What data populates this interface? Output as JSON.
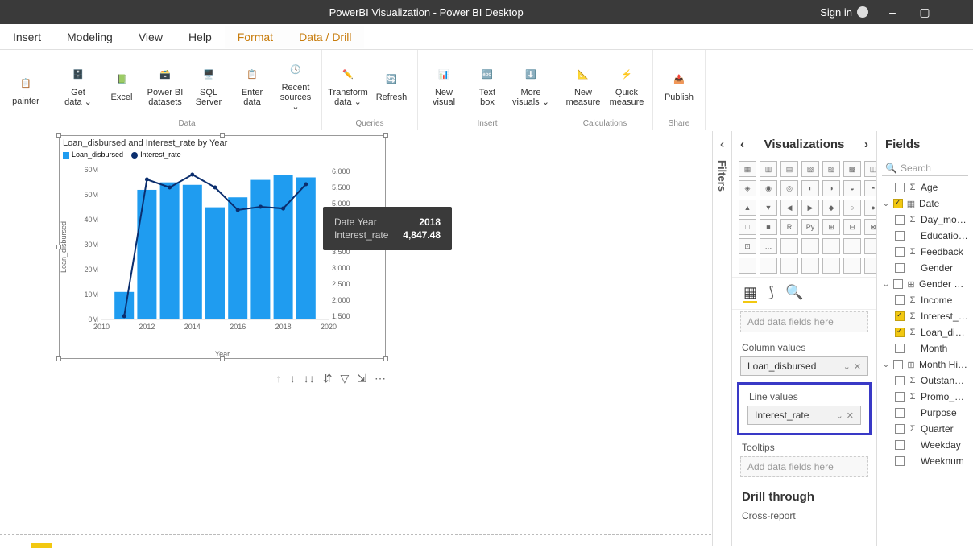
{
  "titlebar": {
    "title": "PowerBI Visualization - Power BI Desktop",
    "signin": "Sign in",
    "minimize": "–",
    "maximize": "▢",
    "close": ""
  },
  "menubar": {
    "items": [
      "Insert",
      "Modeling",
      "View",
      "Help",
      "Format",
      "Data / Drill"
    ],
    "active_from": 4
  },
  "ribbon": {
    "groups": [
      {
        "label": "",
        "items": [
          {
            "label": "painter"
          }
        ]
      },
      {
        "label": "Data",
        "items": [
          {
            "label": "Get\ndata ⌄"
          },
          {
            "label": "Excel"
          },
          {
            "label": "Power BI\ndatasets"
          },
          {
            "label": "SQL\nServer"
          },
          {
            "label": "Enter\ndata"
          },
          {
            "label": "Recent\nsources ⌄"
          }
        ]
      },
      {
        "label": "Queries",
        "items": [
          {
            "label": "Transform\ndata ⌄"
          },
          {
            "label": "Refresh"
          }
        ]
      },
      {
        "label": "Insert",
        "items": [
          {
            "label": "New\nvisual"
          },
          {
            "label": "Text\nbox"
          },
          {
            "label": "More\nvisuals ⌄"
          }
        ]
      },
      {
        "label": "Calculations",
        "items": [
          {
            "label": "New\nmeasure"
          },
          {
            "label": "Quick\nmeasure"
          }
        ]
      },
      {
        "label": "Share",
        "items": [
          {
            "label": "Publish"
          }
        ]
      }
    ]
  },
  "chart_data": {
    "type": "bar+line",
    "title": "Loan_disbursed and Interest_rate by Year",
    "legend": [
      {
        "name": "Loan_disbursed",
        "color": "#1f9cf0"
      },
      {
        "name": "Interest_rate",
        "color": "#0b2e6e"
      }
    ],
    "xlabel": "Year",
    "ylabel": "Loan_disbursed",
    "x_ticks": [
      2010,
      2012,
      2014,
      2016,
      2018,
      2020
    ],
    "y_ticks": [
      "0M",
      "10M",
      "20M",
      "30M",
      "40M",
      "50M",
      "60M"
    ],
    "y2_ticks": [
      1500,
      2000,
      2500,
      3000,
      3500,
      4000,
      4500,
      5000,
      5500,
      6000
    ],
    "categories": [
      2011,
      2012,
      2013,
      2014,
      2015,
      2016,
      2017,
      2018,
      2019
    ],
    "series": [
      {
        "name": "Loan_disbursed",
        "type": "bar",
        "axis": "y",
        "values": [
          11,
          52,
          55,
          54,
          45,
          49,
          56,
          58,
          57
        ]
      },
      {
        "name": "Interest_rate",
        "type": "line",
        "axis": "y2",
        "values": [
          1500,
          5750,
          5500,
          5900,
          5500,
          4800,
          4900,
          4847.48,
          5600
        ]
      }
    ],
    "ylim": [
      0,
      62
    ],
    "y2lim": [
      1400,
      6200
    ]
  },
  "tooltip": {
    "rows": [
      {
        "k": "Date Year",
        "v": "2018"
      },
      {
        "k": "Interest_rate",
        "v": "4,847.48"
      }
    ]
  },
  "chart_toolbar": [
    "↑",
    "↓",
    "↓↓",
    "⇵",
    "▽",
    "⇲",
    "⋯"
  ],
  "visualizations": {
    "header": "Visualizations",
    "tabs": [
      "▦",
      "⟆",
      "🔍"
    ],
    "axis": {
      "label": "",
      "box": "Add data fields here"
    },
    "column_values": {
      "label": "Column values",
      "pill": "Loan_disbursed"
    },
    "line_values": {
      "label": "Line values",
      "pill": "Interest_rate"
    },
    "tooltips": {
      "label": "Tooltips",
      "box": "Add data fields here"
    },
    "drillthrough": "Drill through",
    "crossreport": "Cross-report"
  },
  "filters": {
    "label": "Filters"
  },
  "fields": {
    "header": "Fields",
    "search": "Search",
    "items": [
      {
        "label": "Age",
        "icon": "Σ",
        "expand": "",
        "checked": false,
        "indent": true
      },
      {
        "label": "Date",
        "icon": "▦",
        "expand": "⌄",
        "checked": true,
        "indent": false,
        "hier": true
      },
      {
        "label": "Day_month",
        "icon": "Σ",
        "expand": "",
        "checked": false,
        "indent": true
      },
      {
        "label": "Education_l...",
        "icon": "",
        "expand": "",
        "checked": false,
        "indent": true
      },
      {
        "label": "Feedback",
        "icon": "Σ",
        "expand": "",
        "checked": false,
        "indent": true
      },
      {
        "label": "Gender",
        "icon": "",
        "expand": "",
        "checked": false,
        "indent": true
      },
      {
        "label": "Gender Hie...",
        "icon": "⊞",
        "expand": "⌄",
        "checked": false,
        "indent": false,
        "hier": true
      },
      {
        "label": "Income",
        "icon": "Σ",
        "expand": "",
        "checked": false,
        "indent": true
      },
      {
        "label": "Interest_rate",
        "icon": "Σ",
        "expand": "",
        "checked": true,
        "indent": true
      },
      {
        "label": "Loan_disbu...",
        "icon": "Σ",
        "expand": "",
        "checked": true,
        "indent": true
      },
      {
        "label": "Month",
        "icon": "",
        "expand": "",
        "checked": false,
        "indent": true
      },
      {
        "label": "Month Hier...",
        "icon": "⊞",
        "expand": "⌄",
        "checked": false,
        "indent": false,
        "hier": true
      },
      {
        "label": "Outstandin...",
        "icon": "Σ",
        "expand": "",
        "checked": false,
        "indent": true
      },
      {
        "label": "Promo_Ca...",
        "icon": "Σ",
        "expand": "",
        "checked": false,
        "indent": true
      },
      {
        "label": "Purpose",
        "icon": "",
        "expand": "",
        "checked": false,
        "indent": true
      },
      {
        "label": "Quarter",
        "icon": "Σ",
        "expand": "",
        "checked": false,
        "indent": true
      },
      {
        "label": "Weekday",
        "icon": "",
        "expand": "",
        "checked": false,
        "indent": true
      },
      {
        "label": "Weeknum",
        "icon": "",
        "expand": "",
        "checked": false,
        "indent": true
      }
    ]
  }
}
